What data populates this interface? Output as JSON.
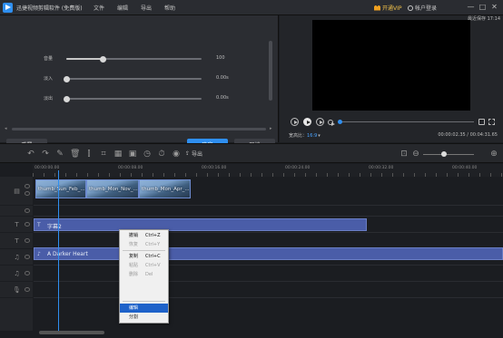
{
  "app": {
    "title": "迅捷视频剪辑软件 (免费版)",
    "menu": [
      "文件",
      "编辑",
      "导出",
      "帮助"
    ],
    "vip_label": "开通VIP",
    "login_label": "帐户登录",
    "window_buttons": [
      "—",
      "□",
      "✕"
    ]
  },
  "props": {
    "rows": [
      {
        "label": "音量",
        "value": "100",
        "level": 0.27
      },
      {
        "label": "淡入",
        "value": "0.00s",
        "level": 0.0
      },
      {
        "label": "淡出",
        "value": "0.00s",
        "level": 0.0
      }
    ],
    "reset_label": "重置",
    "ok_label": "确定",
    "cancel_label": "取消"
  },
  "preview": {
    "recent_save": "最近保存 17:14",
    "aspect_label": "宽高比：",
    "aspect_value": "16:9",
    "timecode": "00:00:02.35 / 00:04:31.65",
    "progress": 0.01
  },
  "toolbar": {
    "icons": [
      "undo-icon",
      "redo-icon",
      "edit-icon",
      "delete-icon",
      "split-icon",
      "crop-icon",
      "mosaic-icon",
      "freeze-icon",
      "speed-icon",
      "duration-icon",
      "record-icon"
    ],
    "export_label": "导出",
    "zoom_level": 0.36
  },
  "ruler": {
    "labels": [
      "00:00:00.00",
      "00:00:08.00",
      "00:00:16.00",
      "00:00:24.00",
      "00:00:32.00",
      "00:00:40.00"
    ]
  },
  "tracks": {
    "video_clips": [
      "thumb_Sun_Feb_...",
      "thumb_Mon_Nov_...",
      "thumb_Mon_Apr_..."
    ],
    "subtitle_clip": "字幕2",
    "audio_clip": "A Darker Heart"
  },
  "context_menu": {
    "items": [
      {
        "label": "撤销",
        "shortcut": "Ctrl+Z",
        "enabled": true
      },
      {
        "label": "恢复",
        "shortcut": "Ctrl+Y",
        "enabled": false
      },
      {
        "label": "复制",
        "shortcut": "Ctrl+C",
        "enabled": true
      },
      {
        "label": "粘贴",
        "shortcut": "Ctrl+V",
        "enabled": false
      },
      {
        "label": "删除",
        "shortcut": "Del",
        "enabled": false
      },
      {
        "label": "编辑",
        "shortcut": "",
        "enabled": true,
        "hover": true
      },
      {
        "label": "分割",
        "shortcut": "",
        "enabled": true
      }
    ]
  }
}
